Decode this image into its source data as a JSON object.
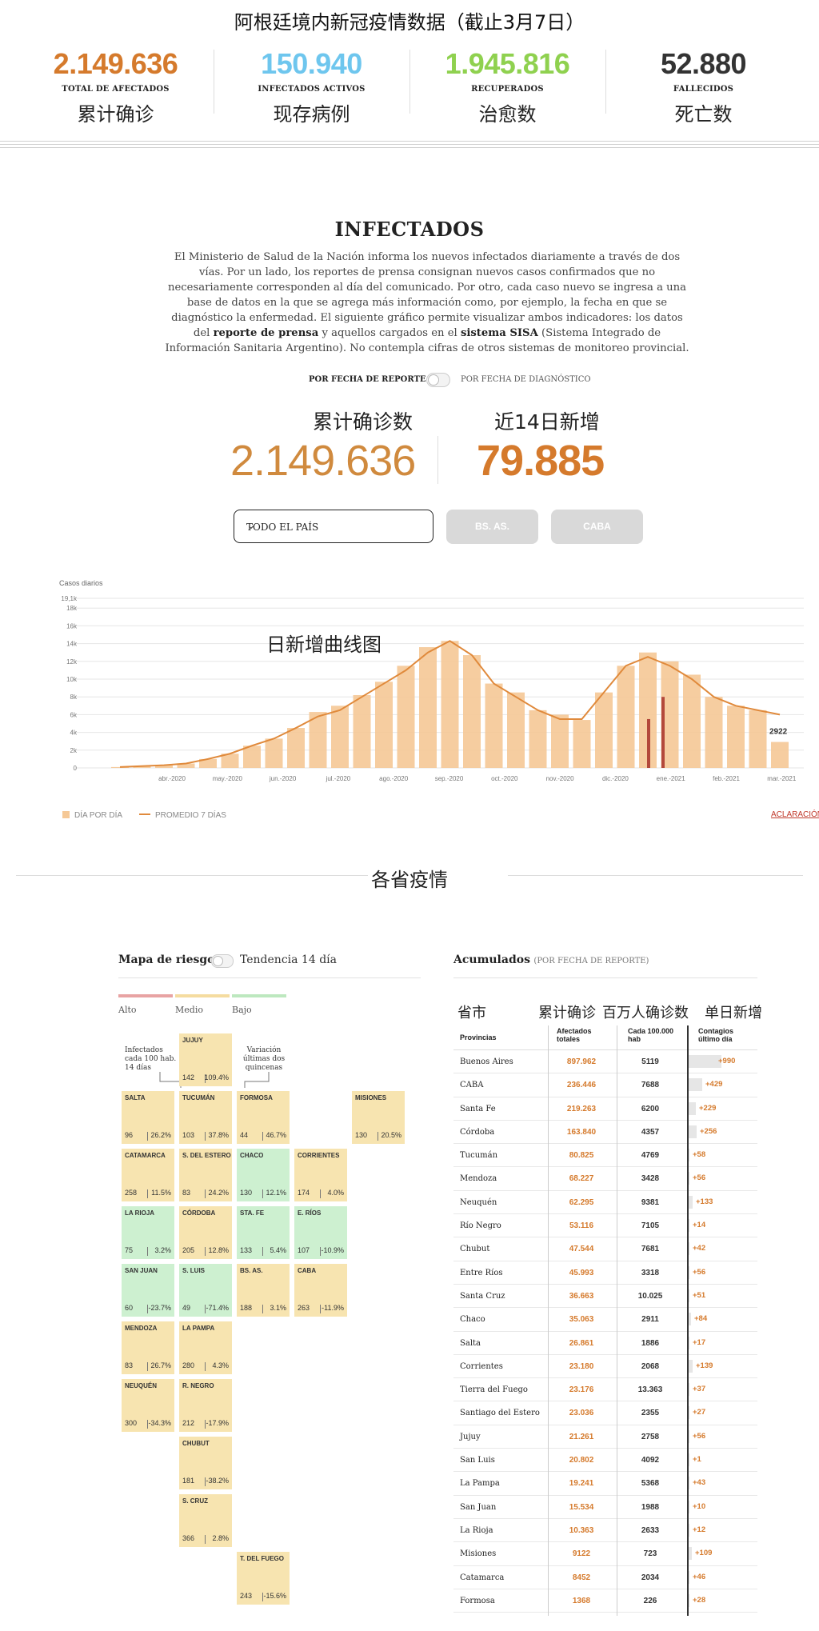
{
  "top_title": "阿根廷境内新冠疫情数据（截止3月7日）",
  "stats": [
    {
      "value": "2.149.636",
      "label": "TOTAL DE AFECTADOS",
      "zh": "累计确诊",
      "color": "#d57a2c"
    },
    {
      "value": "150.940",
      "label": "INFECTADOS ACTIVOS",
      "zh": "现存病例",
      "color": "#6ec6ee"
    },
    {
      "value": "1.945.816",
      "label": "RECUPERADOS",
      "zh": "治愈数",
      "color": "#8fd14f"
    },
    {
      "value": "52.880",
      "label": "FALLECIDOS",
      "zh": "死亡数",
      "color": "#333333"
    }
  ],
  "infectados": {
    "title": "INFECTADOS",
    "desc_1": "El Ministerio de Salud de la Nación informa los nuevos infectados diariamente a través de dos vías. Por un lado, los reportes de prensa consignan nuevos casos confirmados que no necesariamente corresponden al día del comunicado. Por otro, cada caso nuevo se ingresa a una base de datos en la que se agrega más información como, por ejemplo, la fecha en que se diagnóstico la enfermedad. El siguiente gráfico permite visualizar ambos indicadores: los datos del ",
    "desc_b1": "reporte de prensa",
    "desc_2": " y aquellos cargados en el ",
    "desc_b2": "sistema SISA",
    "desc_3": " (Sistema Integrado de Información Sanitaria Argentino). No contempla cifras de otros sistemas de monitoreo provincial."
  },
  "toggle": {
    "left": "POR FECHA DE REPORTE",
    "right": "POR FECHA DE DIAGNÓSTICO"
  },
  "big": {
    "total_zh": "累计确诊数",
    "total": "2.149.636",
    "recent_zh": "近14日新增",
    "recent": "79.885"
  },
  "region": {
    "selected": "TODO EL PAÍS",
    "btn1": "BS. AS.",
    "btn2": "CABA"
  },
  "chart_zh": "日新增曲线图",
  "chart_data": {
    "type": "bar",
    "ylabel": "Casos diarios",
    "y_ticks": [
      "0",
      "2k",
      "4k",
      "6k",
      "8k",
      "10k",
      "12k",
      "14k",
      "16k",
      "18k",
      "19,1k"
    ],
    "ylim": [
      0,
      19100
    ],
    "x_ticks": [
      "abr.-2020",
      "may.-2020",
      "jun.-2020",
      "jul.-2020",
      "ago.-2020",
      "sep.-2020",
      "oct.-2020",
      "nov.-2020",
      "dic.-2020",
      "ene.-2021",
      "feb.-2021",
      "mar.-2021"
    ],
    "series": [
      {
        "name": "DÍA POR DÍA",
        "values": [
          100,
          200,
          300,
          500,
          1000,
          1600,
          2500,
          3300,
          4500,
          6300,
          7000,
          8200,
          9700,
          11500,
          13600,
          14300,
          12700,
          9500,
          8500,
          6500,
          6000,
          5400,
          8500,
          11500,
          13000,
          12000,
          10500,
          8000,
          7000,
          6500,
          2922
        ]
      },
      {
        "name": "PROMEDIO 7 DÍAS",
        "values": [
          100,
          200,
          300,
          500,
          1000,
          1600,
          2500,
          3300,
          4500,
          5800,
          6500,
          8000,
          9500,
          11000,
          13000,
          14300,
          12700,
          9500,
          8000,
          6500,
          5500,
          5500,
          8500,
          11500,
          12500,
          11500,
          10000,
          8000,
          7000,
          6500,
          6000
        ]
      }
    ],
    "last_label": "2922",
    "legend": [
      "DÍA POR DÍA",
      "PROMEDIO 7 DÍAS"
    ]
  },
  "aclaracion": "ACLARACIÓN",
  "provinces_title": "各省疫情",
  "risk": {
    "title": "Mapa de riesgo",
    "trend": "Tendencia 14 día",
    "levels": [
      {
        "label": "Alto",
        "color": "#e8a3a3"
      },
      {
        "label": "Medio",
        "color": "#f5dca0"
      },
      {
        "label": "Bajo",
        "color": "#bde8bf"
      }
    ],
    "anno_left": "Infectados cada 100 hab. 14 días",
    "anno_right": "Variación últimas dos quincenas",
    "tiles": [
      {
        "name": "JUJUY",
        "a": "142",
        "b": "109.4%",
        "c": "y"
      },
      {
        "name": "SALTA",
        "a": "96",
        "b": "26.2%",
        "c": "y"
      },
      {
        "name": "TUCUMÁN",
        "a": "103",
        "b": "37.8%",
        "c": "y"
      },
      {
        "name": "FORMOSA",
        "a": "44",
        "b": "46.7%",
        "c": "y"
      },
      {
        "name": "MISIONES",
        "a": "130",
        "b": "20.5%",
        "c": "y"
      },
      {
        "name": "CATAMARCA",
        "a": "258",
        "b": "11.5%",
        "c": "y"
      },
      {
        "name": "S. DEL ESTERO",
        "a": "83",
        "b": "24.2%",
        "c": "y"
      },
      {
        "name": "CHACO",
        "a": "130",
        "b": "12.1%",
        "c": "g"
      },
      {
        "name": "CORRIENTES",
        "a": "174",
        "b": "4.0%",
        "c": "y"
      },
      {
        "name": "LA RIOJA",
        "a": "75",
        "b": "3.2%",
        "c": "g"
      },
      {
        "name": "CÓRDOBA",
        "a": "205",
        "b": "12.8%",
        "c": "y"
      },
      {
        "name": "STA. FE",
        "a": "133",
        "b": "5.4%",
        "c": "g"
      },
      {
        "name": "E. RÍOS",
        "a": "107",
        "b": "-10.9%",
        "c": "g"
      },
      {
        "name": "SAN JUAN",
        "a": "60",
        "b": "-23.7%",
        "c": "g"
      },
      {
        "name": "S. LUIS",
        "a": "49",
        "b": "-71.4%",
        "c": "g"
      },
      {
        "name": "BS. AS.",
        "a": "188",
        "b": "3.1%",
        "c": "y"
      },
      {
        "name": "CABA",
        "a": "263",
        "b": "-11.9%",
        "c": "y"
      },
      {
        "name": "MENDOZA",
        "a": "83",
        "b": "26.7%",
        "c": "y"
      },
      {
        "name": "LA PAMPA",
        "a": "280",
        "b": "4.3%",
        "c": "y"
      },
      {
        "name": "NEUQUÉN",
        "a": "300",
        "b": "-34.3%",
        "c": "y"
      },
      {
        "name": "R. NEGRO",
        "a": "212",
        "b": "-17.9%",
        "c": "y"
      },
      {
        "name": "CHUBUT",
        "a": "181",
        "b": "-38.2%",
        "c": "y"
      },
      {
        "name": "S. CRUZ",
        "a": "366",
        "b": "2.8%",
        "c": "y"
      },
      {
        "name": "T. DEL FUEGO",
        "a": "243",
        "b": "-15.6%",
        "c": "y"
      }
    ]
  },
  "acc": {
    "title": "Acumulados",
    "subtitle": "(POR FECHA DE REPORTE)",
    "zh_cols": [
      "省市",
      "累计确诊",
      "百万人确诊数",
      "单日新增"
    ],
    "headers": [
      "Provincias",
      "Afectados totales",
      "Cada 100.000 hab",
      "Contagios último día"
    ],
    "rows": [
      {
        "p": "Buenos Aires",
        "t": "897.962",
        "h": "5119",
        "d": "+990",
        "v": 990
      },
      {
        "p": "CABA",
        "t": "236.446",
        "h": "7688",
        "d": "+429",
        "v": 429
      },
      {
        "p": "Santa Fe",
        "t": "219.263",
        "h": "6200",
        "d": "+229",
        "v": 229
      },
      {
        "p": "Córdoba",
        "t": "163.840",
        "h": "4357",
        "d": "+256",
        "v": 256
      },
      {
        "p": "Tucumán",
        "t": "80.825",
        "h": "4769",
        "d": "+58",
        "v": 58
      },
      {
        "p": "Mendoza",
        "t": "68.227",
        "h": "3428",
        "d": "+56",
        "v": 56
      },
      {
        "p": "Neuquén",
        "t": "62.295",
        "h": "9381",
        "d": "+133",
        "v": 133
      },
      {
        "p": "Río Negro",
        "t": "53.116",
        "h": "7105",
        "d": "+14",
        "v": 14
      },
      {
        "p": "Chubut",
        "t": "47.544",
        "h": "7681",
        "d": "+42",
        "v": 42
      },
      {
        "p": "Entre Ríos",
        "t": "45.993",
        "h": "3318",
        "d": "+56",
        "v": 56
      },
      {
        "p": "Santa Cruz",
        "t": "36.663",
        "h": "10.025",
        "d": "+51",
        "v": 51
      },
      {
        "p": "Chaco",
        "t": "35.063",
        "h": "2911",
        "d": "+84",
        "v": 84
      },
      {
        "p": "Salta",
        "t": "26.861",
        "h": "1886",
        "d": "+17",
        "v": 17
      },
      {
        "p": "Corrientes",
        "t": "23.180",
        "h": "2068",
        "d": "+139",
        "v": 139
      },
      {
        "p": "Tierra del Fuego",
        "t": "23.176",
        "h": "13.363",
        "d": "+37",
        "v": 37
      },
      {
        "p": "Santiago del Estero",
        "t": "23.036",
        "h": "2355",
        "d": "+27",
        "v": 27
      },
      {
        "p": "Jujuy",
        "t": "21.261",
        "h": "2758",
        "d": "+56",
        "v": 56
      },
      {
        "p": "San Luis",
        "t": "20.802",
        "h": "4092",
        "d": "+1",
        "v": 1
      },
      {
        "p": "La Pampa",
        "t": "19.241",
        "h": "5368",
        "d": "+43",
        "v": 43
      },
      {
        "p": "San Juan",
        "t": "15.534",
        "h": "1988",
        "d": "+10",
        "v": 10
      },
      {
        "p": "La Rioja",
        "t": "10.363",
        "h": "2633",
        "d": "+12",
        "v": 12
      },
      {
        "p": "Misiones",
        "t": "9122",
        "h": "723",
        "d": "+109",
        "v": 109
      },
      {
        "p": "Catamarca",
        "t": "8452",
        "h": "2034",
        "d": "+46",
        "v": 46
      },
      {
        "p": "Formosa",
        "t": "1368",
        "h": "226",
        "d": "+28",
        "v": 28
      }
    ]
  }
}
